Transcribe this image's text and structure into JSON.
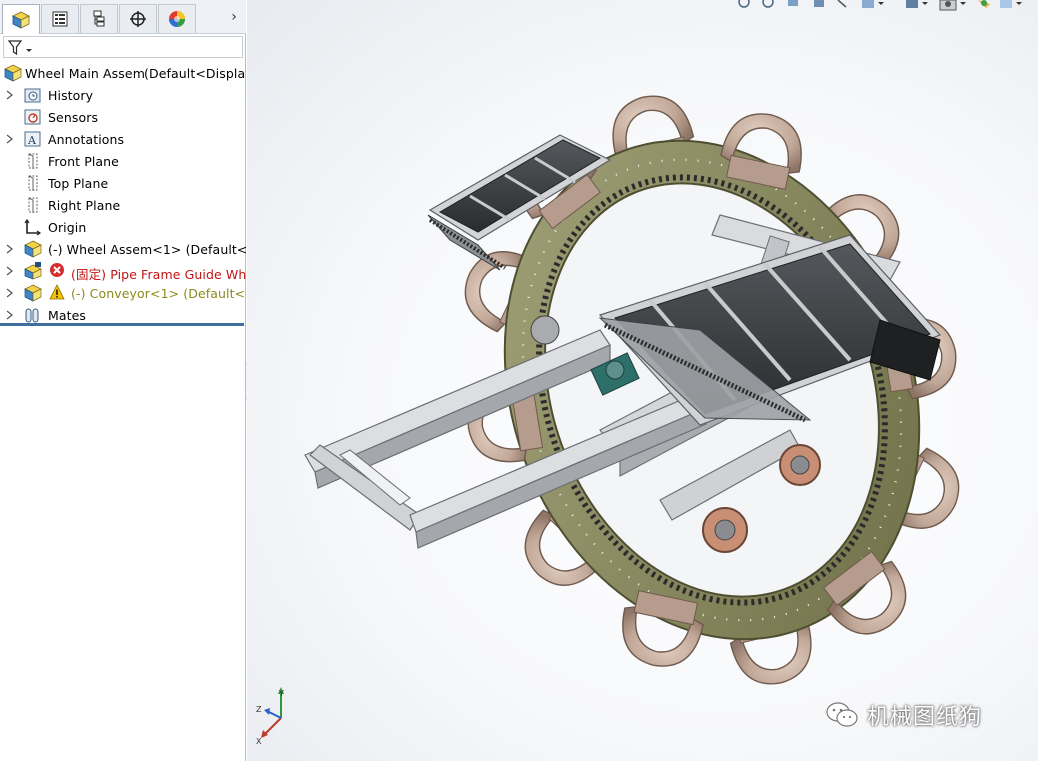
{
  "feature_tree": {
    "tabs": [
      {
        "name": "featuremanager-tab",
        "icon": "assembly-icon"
      },
      {
        "name": "propertymanager-tab",
        "icon": "property-list-icon"
      },
      {
        "name": "configurationmanager-tab",
        "icon": "configuration-icon"
      },
      {
        "name": "dimxpert-tab",
        "icon": "crosshair-icon"
      },
      {
        "name": "displaymanager-tab",
        "icon": "color-wheel-icon"
      }
    ],
    "root": {
      "label": "Wheel Main Assem",
      "config": "(Default<Display"
    },
    "items": [
      {
        "label": "History",
        "icon": "history-folder-icon",
        "expandable": true
      },
      {
        "label": "Sensors",
        "icon": "sensor-icon",
        "expandable": false
      },
      {
        "label": "Annotations",
        "icon": "annotation-icon",
        "expandable": true
      },
      {
        "label": "Front Plane",
        "icon": "plane-icon",
        "expandable": false
      },
      {
        "label": "Top Plane",
        "icon": "plane-icon",
        "expandable": false
      },
      {
        "label": "Right Plane",
        "icon": "plane-icon",
        "expandable": false
      },
      {
        "label": "Origin",
        "icon": "origin-icon",
        "expandable": false
      },
      {
        "label": "(-) Wheel Assem<1> (Default<Dis",
        "icon": "subassembly-icon",
        "expandable": true,
        "status": "normal"
      },
      {
        "label": "(固定) Pipe Frame Guide Whee",
        "icon": "subassembly-error-icon",
        "expandable": true,
        "status": "error"
      },
      {
        "label": "(-) Conveyor<1> (Default<Dis",
        "icon": "subassembly-warning-icon",
        "expandable": true,
        "status": "warning"
      },
      {
        "label": "Mates",
        "icon": "mates-icon",
        "expandable": true
      }
    ]
  },
  "triad": {
    "x": "X",
    "y": "Y",
    "z": "Z"
  },
  "watermark": {
    "text": "机械图纸狗",
    "icon": "wechat-icon"
  },
  "colors": {
    "ring": "#8a8a5c",
    "pads": "#bfa494",
    "belt": "#3a3d40",
    "frame": "#c7c9cc",
    "error": "#c01414",
    "warning": "#8a8a1e",
    "tree_underline": "#3f6f9f"
  }
}
